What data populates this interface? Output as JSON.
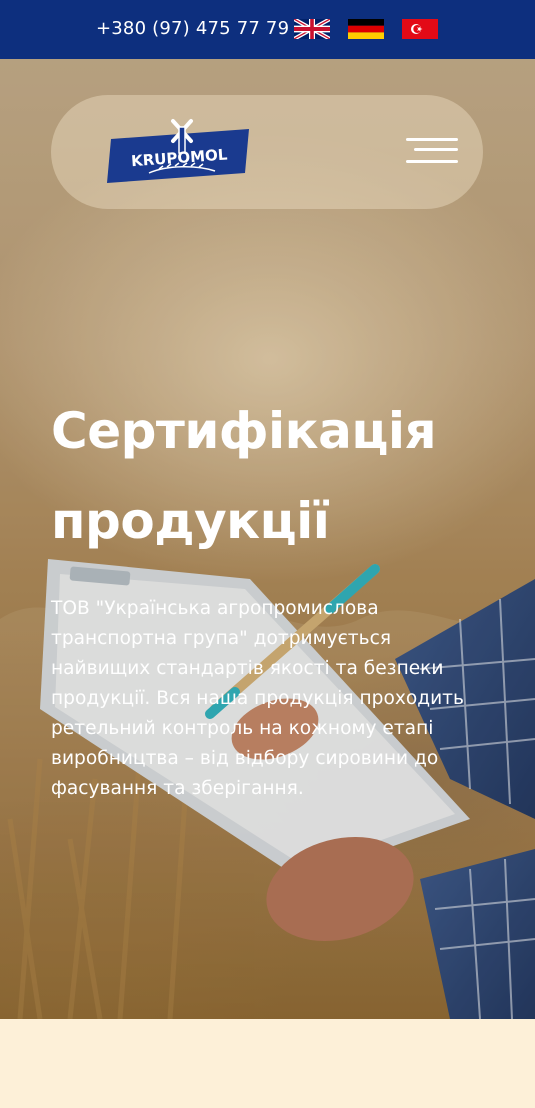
{
  "topbar": {
    "phone": "+380 (97) 475 77 79",
    "languages": [
      {
        "code": "en",
        "flag": "uk-flag-icon"
      },
      {
        "code": "de",
        "flag": "germany-flag-icon"
      },
      {
        "code": "tr",
        "flag": "turkey-flag-icon"
      }
    ]
  },
  "header": {
    "logo_text": "KRUPOMOL",
    "menu_icon": "hamburger-menu-icon"
  },
  "hero": {
    "title": "Сертифікація продукції",
    "description": "ТОВ \"Українська агропромислова транспортна група\" дотримується найвищих стандартів якості та безпеки продукції. Вся наша продукція проходить ретельний контроль на кожному етапі виробництва – від відбору сировини до фасування та зберігання."
  },
  "colors": {
    "topbar_bg": "#0d2f7e",
    "logo_blue": "#1a3a8f",
    "page_bg": "#fdf0d8",
    "text_white": "#ffffff"
  }
}
